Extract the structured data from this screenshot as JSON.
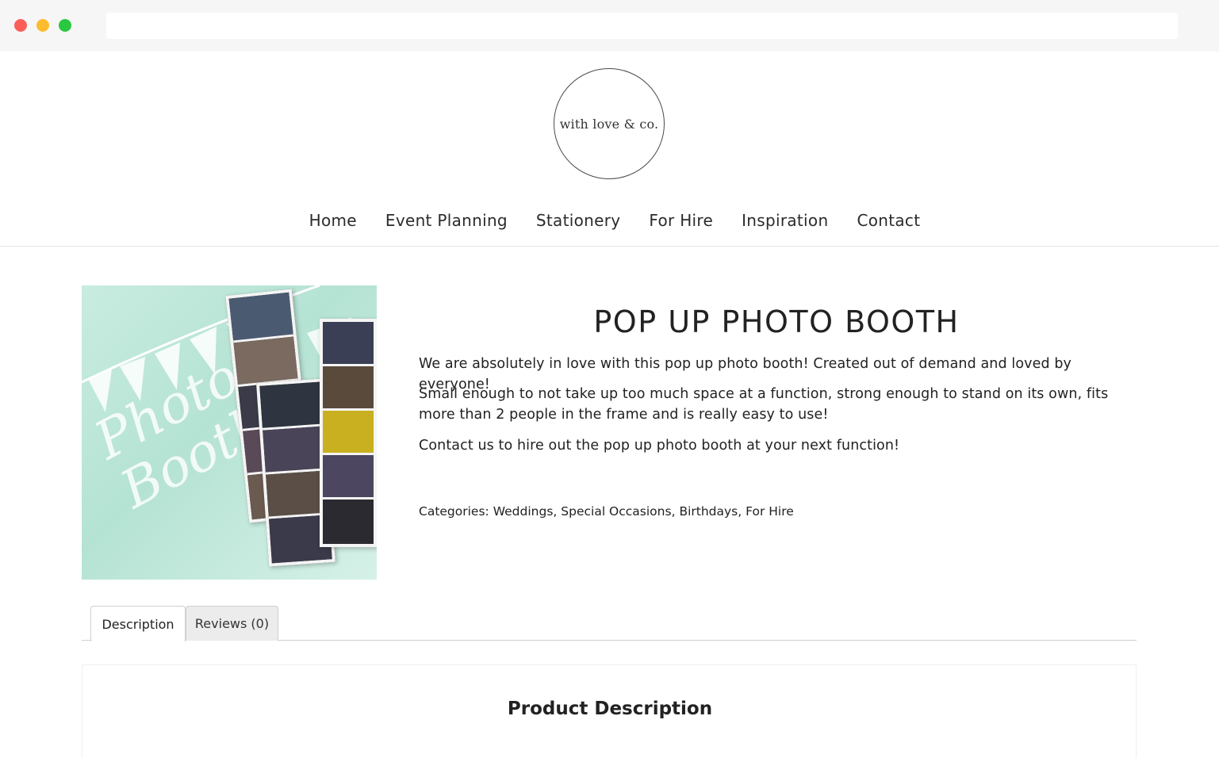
{
  "browser": {
    "controls": [
      "close",
      "minimize",
      "maximize"
    ]
  },
  "logo": {
    "text": "with love & co."
  },
  "nav": {
    "items": [
      {
        "label": "Home"
      },
      {
        "label": "Event Planning"
      },
      {
        "label": "Stationery"
      },
      {
        "label": "For Hire"
      },
      {
        "label": "Inspiration"
      },
      {
        "label": "Contact"
      }
    ]
  },
  "product": {
    "image_text": "Photo Booth",
    "title": "POP UP PHOTO BOOTH",
    "description": [
      "We are absolutely in love with this pop up photo booth! Created out of demand and loved by everyone!",
      "Small enough to not take up too much space at a function, strong enough to stand on its own, fits more than 2 people in the frame and is really easy to use!",
      "Contact us to hire out the pop up photo booth at your next function!"
    ],
    "categories_label": "Categories:",
    "categories": [
      "Weddings",
      "Special Occasions",
      "Birthdays",
      "For Hire"
    ]
  },
  "tabs": [
    {
      "label": "Description",
      "active": true
    },
    {
      "label": "Reviews (0)",
      "active": false
    }
  ],
  "panel": {
    "title": "Product Description"
  },
  "colors": {
    "chrome_bg": "#f6f6f6",
    "close": "#fc5f57",
    "minimize": "#fdbc2e",
    "maximize": "#28c840",
    "image_mint": "#b5e3d3",
    "text": "#222222"
  }
}
